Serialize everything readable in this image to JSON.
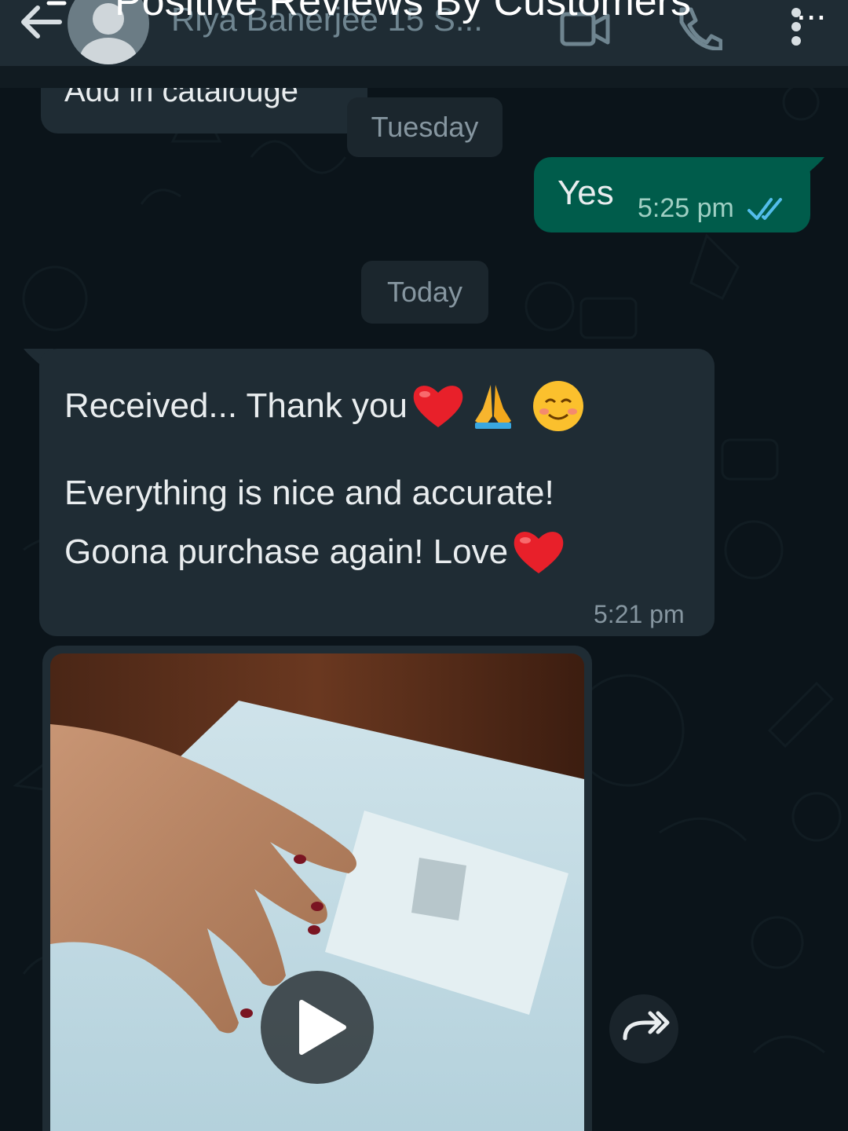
{
  "overlay": {
    "title": "Positive Reviews By Customers",
    "title_ellipsis": "..."
  },
  "header": {
    "contact_name": "Riya Banerjee 15 S...",
    "icons": [
      "back-arrow-icon",
      "avatar-icon",
      "video-call-icon",
      "phone-icon",
      "more-vert-icon"
    ]
  },
  "messages": {
    "previous_text": "Add in catalouge",
    "date_tuesday": "Tuesday",
    "yes": {
      "text": "Yes",
      "time": "5:25 pm",
      "status": "read"
    },
    "date_today": "Today",
    "received": {
      "line1": "Received... Thank you",
      "line2": "Everything is nice and accurate!",
      "line3": "Goona purchase again! Love",
      "time": "5:21 pm"
    }
  },
  "media": {
    "type": "video",
    "play_icon": "play-icon",
    "forward_icon": "forward-icon"
  },
  "colors": {
    "background": "#0b141a",
    "header": "#1f2c34",
    "incoming_bubble": "#1f2c34",
    "outgoing_bubble": "#005c4b",
    "read_ticks": "#53bdeb",
    "text": "#e9edef",
    "muted": "#8696a0"
  }
}
